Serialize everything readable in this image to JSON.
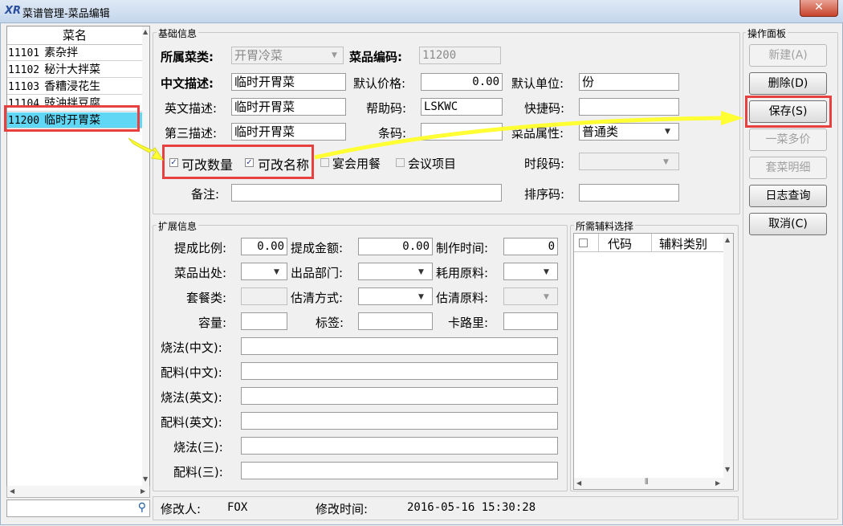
{
  "window": {
    "logo": "XR",
    "title": "菜谱管理-菜品编辑",
    "close": "✕"
  },
  "dish_list": {
    "header": "菜名",
    "items": [
      {
        "code": "11101",
        "name": "素杂拌"
      },
      {
        "code": "11102",
        "name": "秘汁大拌菜"
      },
      {
        "code": "11103",
        "name": "香糟浸花生"
      },
      {
        "code": "11104",
        "name": "豉油拌豆腐"
      },
      {
        "code": "11200",
        "name": "临时开胃菜",
        "selected": true
      }
    ]
  },
  "basic": {
    "group_label": "基础信息",
    "category_label": "所属菜类:",
    "category_value": "开胃冷菜",
    "code_label": "菜品编码:",
    "code_value": "11200",
    "cn_name_label": "中文描述:",
    "cn_name_value": "临时开胃菜",
    "price_label": "默认价格:",
    "price_value": "0.00",
    "unit_label": "默认单位:",
    "unit_value": "份",
    "en_name_label": "英文描述:",
    "en_name_value": "临时开胃菜",
    "help_code_label": "帮助码:",
    "help_code_value": "LSKWC",
    "shortcut_label": "快捷码:",
    "shortcut_value": "",
    "third_label": "第三描述:",
    "third_value": "临时开胃菜",
    "barcode_label": "条码:",
    "barcode_value": "",
    "attr_label": "菜品属性:",
    "attr_value": "普通类",
    "chk_qty_label": "可改数量",
    "chk_qty": true,
    "chk_name_label": "可改名称",
    "chk_name": true,
    "chk_banquet_label": "宴会用餐",
    "chk_banquet": false,
    "chk_meeting_label": "会议项目",
    "chk_meeting": false,
    "period_label": "时段码:",
    "period_value": "",
    "remark_label": "备注:",
    "remark_value": "",
    "sort_label": "排序码:",
    "sort_value": ""
  },
  "ext": {
    "group_label": "扩展信息",
    "commission_ratio_label": "提成比例:",
    "commission_ratio_value": "0.00",
    "commission_amount_label": "提成金额:",
    "commission_amount_value": "0.00",
    "make_time_label": "制作时间:",
    "make_time_value": "0",
    "origin_label": "菜品出处:",
    "dept_label": "出品部门:",
    "material_label": "耗用原料:",
    "set_label": "套餐类:",
    "clear_mode_label": "估清方式:",
    "clear_material_label": "估清原料:",
    "capacity_label": "容量:",
    "tag_label": "标签:",
    "calorie_label": "卡路里:",
    "cook_cn_label": "烧法(中文):",
    "ingr_cn_label": "配料(中文):",
    "cook_en_label": "烧法(英文):",
    "ingr_en_label": "配料(英文):",
    "cook_3_label": "烧法(三):",
    "ingr_3_label": "配料(三):"
  },
  "aux": {
    "group_label": "所需辅料选择",
    "col_code": "代码",
    "col_type": "辅料类别"
  },
  "panel": {
    "group_label": "操作面板",
    "new": "新建(A)",
    "delete": "删除(D)",
    "save": "保存(S)",
    "multi_price": "一菜多价",
    "set_detail": "套菜明细",
    "log": "日志查询",
    "cancel": "取消(C)"
  },
  "footer": {
    "modifier_label": "修改人:",
    "modifier_value": "FOX",
    "time_label": "修改时间:",
    "time_value": "2016-05-16 15:30:28"
  },
  "colors": {
    "selection": "#5fd7f5",
    "highlight_box": "#e64040",
    "arrow": "#ffff33"
  }
}
